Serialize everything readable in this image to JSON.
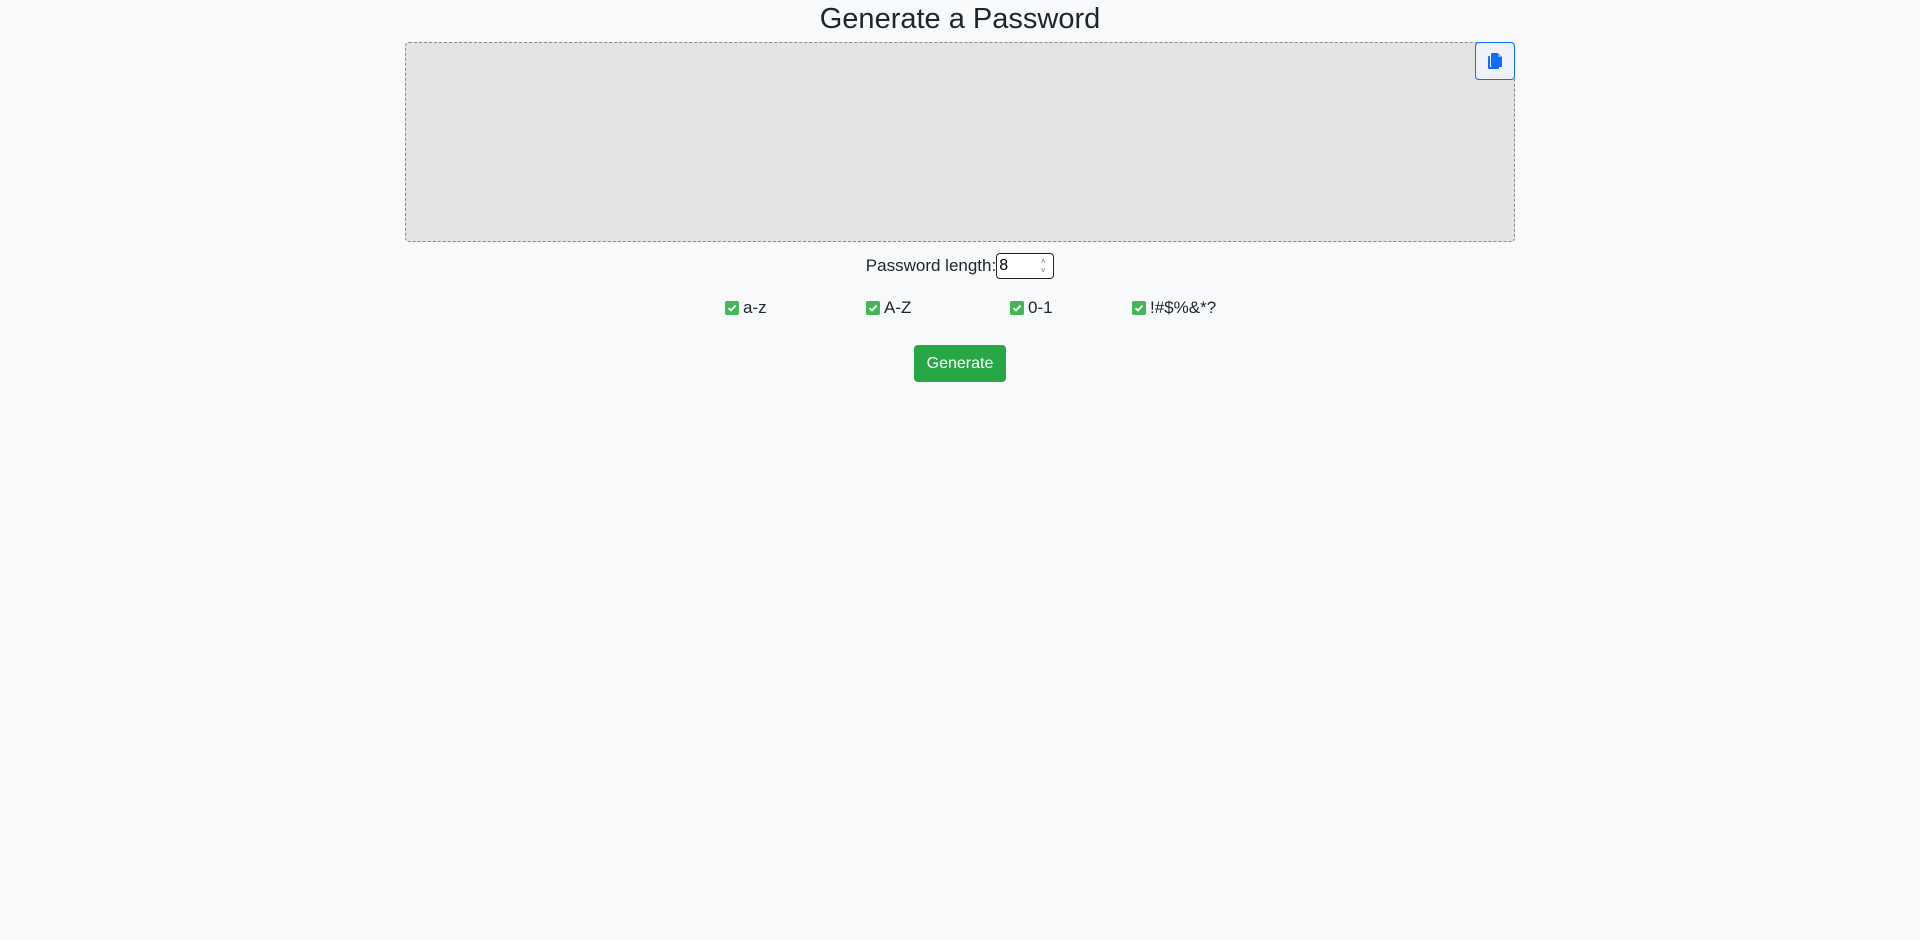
{
  "page": {
    "title": "Generate a Password"
  },
  "output": {
    "password": "",
    "copy_icon": "copy-icon"
  },
  "length": {
    "label": "Password length:",
    "value": "8"
  },
  "options": [
    {
      "label": "a-z",
      "checked": true
    },
    {
      "label": "A-Z",
      "checked": true
    },
    {
      "label": "0-1",
      "checked": true
    },
    {
      "label": "!#$%&*?",
      "checked": true
    }
  ],
  "actions": {
    "generate_label": "Generate"
  },
  "colors": {
    "accent_blue": "#0d6efd",
    "checkbox_green": "#43b655",
    "button_green": "#28a745",
    "output_bg": "#e4e4e4",
    "page_bg": "#f8f9fa"
  }
}
